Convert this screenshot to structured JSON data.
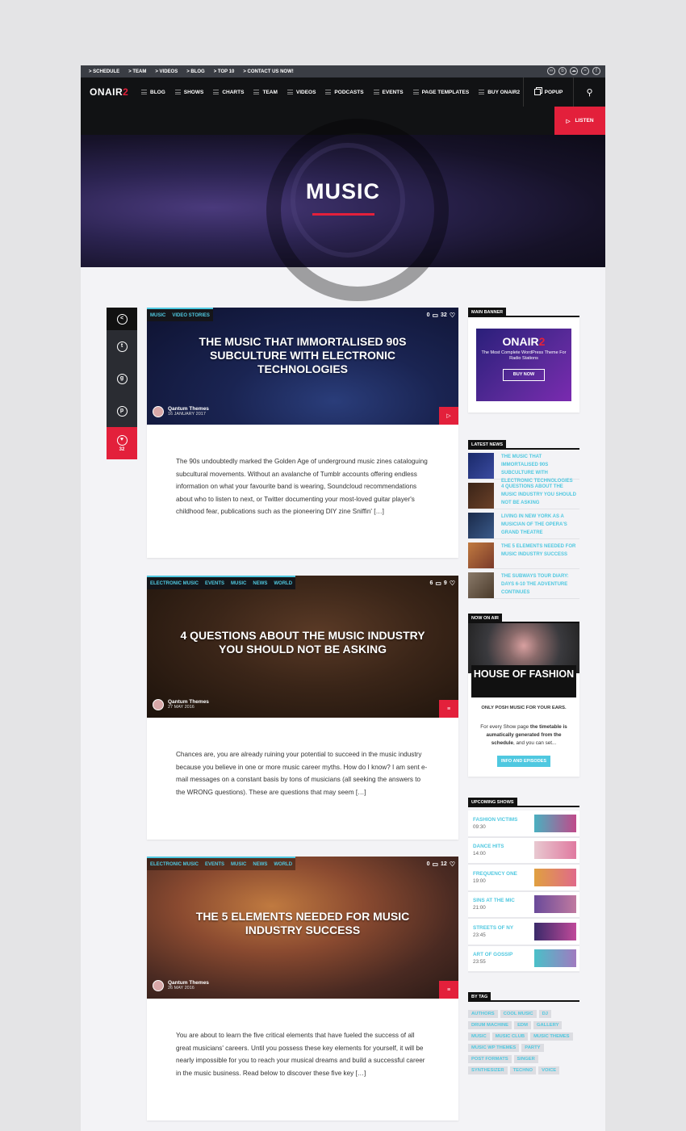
{
  "topbar": {
    "links": [
      "> SCHEDULE",
      "> TEAM",
      "> VIDEOS",
      "> BLOG",
      "> TOP 10",
      "> CONTACT US NOW!"
    ]
  },
  "nav": {
    "logo_main": "ONAIR",
    "logo_accent": "2",
    "items": [
      "BLOG",
      "SHOWS",
      "CHARTS",
      "TEAM",
      "VIDEOS",
      "PODCASTS",
      "EVENTS",
      "PAGE TEMPLATES",
      "BUY ONAIR2"
    ],
    "popup": "POPUP",
    "listen": "LISTEN"
  },
  "hero": {
    "title": "MUSIC"
  },
  "share": {
    "like_count": "32"
  },
  "posts": [
    {
      "tags": [
        "MUSIC",
        "VIDEO STORIES"
      ],
      "comments": "0",
      "likes": "32",
      "title": "THE MUSIC THAT IMMORTALISED 90S SUBCULTURE WITH ELECTRONIC TECHNOLOGIES",
      "author": "Qantum Themes",
      "date": "16 JANUARY 2017",
      "excerpt": "The 90s undoubtedly marked the Golden Age of underground music zines cataloguing subcultural movements. Without an avalanche of Tumblr accounts offering endless information on what your favourite band is wearing, Soundcloud recommendations about who to listen to next, or Twitter documenting your most-loved guitar player's childhood fear, publications such as the pioneering DIY zine Sniffin' […]"
    },
    {
      "tags": [
        "ELECTRONIC MUSIC",
        "EVENTS",
        "MUSIC",
        "NEWS",
        "WORLD"
      ],
      "comments": "6",
      "likes": "9",
      "title": "4 QUESTIONS ABOUT THE MUSIC INDUSTRY YOU SHOULD NOT BE ASKING",
      "author": "Qantum Themes",
      "date": "27 MAY 2016",
      "excerpt": "Chances are, you are already ruining your potential to succeed in the music industry because you believe in one or more music career myths. How do I know? I am sent e-mail messages on a constant basis by tons of musicians (all seeking the answers to the WRONG questions). These are questions that may seem […]"
    },
    {
      "tags": [
        "ELECTRONIC MUSIC",
        "EVENTS",
        "MUSIC",
        "NEWS",
        "WORLD"
      ],
      "comments": "0",
      "likes": "12",
      "title": "THE 5 ELEMENTS NEEDED FOR MUSIC INDUSTRY SUCCESS",
      "author": "Qantum Themes",
      "date": "26 MAY 2016",
      "excerpt": "You are about to learn the five critical elements that have fueled the success of all great musicians' careers. Until you possess these key elements for yourself, it will be nearly impossible for you to reach your musical dreams and build a successful career in the music business. Read below to discover these five key […]"
    }
  ],
  "sidebar": {
    "main_banner_title": "MAIN BANNER",
    "banner_logo_main": "ONAIR",
    "banner_logo_accent": "2",
    "banner_subtitle": "The Most Complete WordPress Theme For Radio Stations",
    "banner_button": "BUY NOW",
    "latest_news_title": "LATEST NEWS",
    "latest_news": [
      "THE MUSIC THAT IMMORTALISED 90S SUBCULTURE WITH ELECTRONIC TECHNOLOGIES",
      "4 QUESTIONS ABOUT THE MUSIC INDUSTRY YOU SHOULD NOT BE ASKING",
      "LIVING IN NEW YORK AS A MUSICIAN OF THE OPERA'S GRAND THEATRE",
      "THE 5 ELEMENTS NEEDED FOR MUSIC INDUSTRY SUCCESS",
      "THE SUBWAYS TOUR DIARY: DAYS 6-10 THE ADVENTURE CONTINUES"
    ],
    "now_on_air_title": "NOW ON AIR",
    "now_on_air_show": "HOUSE OF FASHION",
    "now_on_air_sub": "ONLY POSH MUSIC FOR YOUR EARS.",
    "now_on_air_desc_1": "For every Show page ",
    "now_on_air_desc_bold": "the timetable is aumatically generated from the schedule",
    "now_on_air_desc_2": ", and you can set...",
    "now_on_air_button": "INFO AND EPISODES",
    "upcoming_title": "UPCOMING SHOWS",
    "upcoming": [
      {
        "name": "FASHION VICTIMS",
        "time": "09:30"
      },
      {
        "name": "DANCE HITS",
        "time": "14:00"
      },
      {
        "name": "FREQUENCY ONE",
        "time": "19:00"
      },
      {
        "name": "SINS AT THE MIC",
        "time": "21:00"
      },
      {
        "name": "STREETS OF NY",
        "time": "23:45"
      },
      {
        "name": "ART OF GOSSIP",
        "time": "23:55"
      }
    ],
    "tag_title": "BY TAG",
    "tags": [
      "AUTHORS",
      "COOL MUSIC",
      "DJ",
      "DRUM MACHINE",
      "EDM",
      "GALLERY",
      "MUSIC",
      "MUSIC CLUB",
      "MUSIC THEMES",
      "MUSIC WP THEMES",
      "PARTY",
      "POST FORMATS",
      "SINGER",
      "SYNTHESIZER",
      "TECHNO",
      "VOICE"
    ]
  }
}
